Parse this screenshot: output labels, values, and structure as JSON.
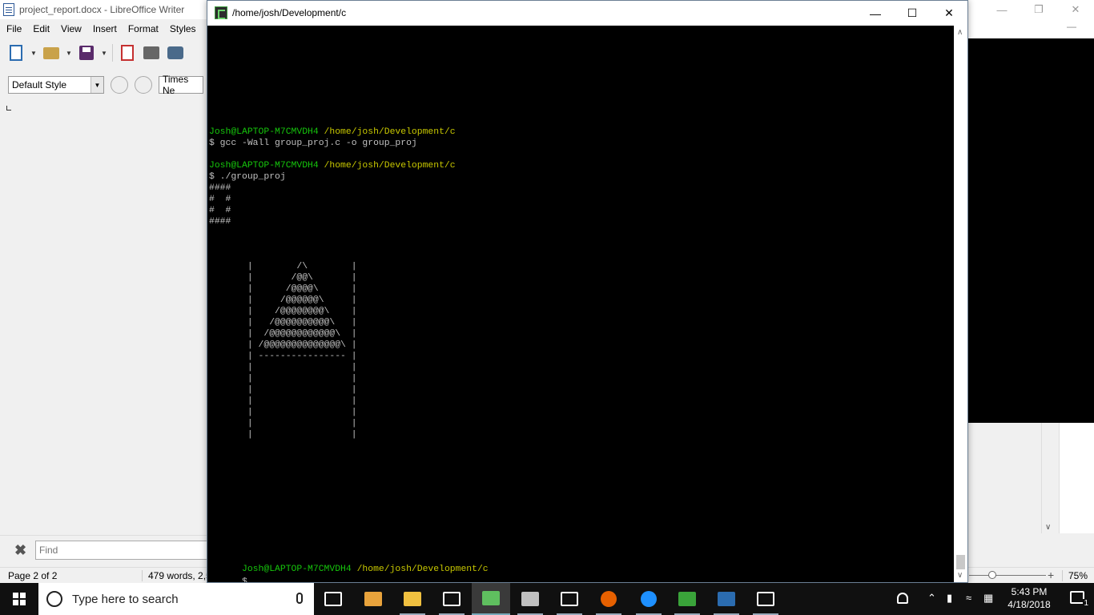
{
  "writer": {
    "title": "project_report.docx - LibreOffice Writer",
    "menu": [
      "File",
      "Edit",
      "View",
      "Insert",
      "Format",
      "Styles"
    ],
    "paragraph_style": "Default Style",
    "font_name": "Times Ne",
    "find_placeholder": "Find",
    "status": {
      "page": "Page 2 of 2",
      "words": "479 words, 2,5",
      "zoom": "75%"
    }
  },
  "terminal": {
    "title": "/home/josh/Development/c",
    "lines": [
      {
        "green": "Josh@LAPTOP-M7CMVDH4",
        "yellow": " /home/josh/Development/c",
        "text": ""
      },
      {
        "green": "",
        "yellow": "",
        "text": "$ gcc -Wall group_proj.c -o group_proj"
      },
      {
        "green": "",
        "yellow": "",
        "text": ""
      },
      {
        "green": "Josh@LAPTOP-M7CMVDH4",
        "yellow": " /home/josh/Development/c",
        "text": ""
      },
      {
        "green": "",
        "yellow": "",
        "text": "$ ./group_proj"
      },
      {
        "green": "",
        "yellow": "",
        "text": "####"
      },
      {
        "green": "",
        "yellow": "",
        "text": "#  #"
      },
      {
        "green": "",
        "yellow": "",
        "text": "#  #"
      },
      {
        "green": "",
        "yellow": "",
        "text": "####"
      },
      {
        "green": "",
        "yellow": "",
        "text": ""
      },
      {
        "green": "",
        "yellow": "",
        "text": ""
      },
      {
        "green": "",
        "yellow": "",
        "text": ""
      },
      {
        "green": "",
        "yellow": "",
        "text": "       |        /\\        |"
      },
      {
        "green": "",
        "yellow": "",
        "text": "       |       /@@\\       |"
      },
      {
        "green": "",
        "yellow": "",
        "text": "       |      /@@@@\\      |"
      },
      {
        "green": "",
        "yellow": "",
        "text": "       |     /@@@@@@\\     |"
      },
      {
        "green": "",
        "yellow": "",
        "text": "       |    /@@@@@@@@\\    |"
      },
      {
        "green": "",
        "yellow": "",
        "text": "       |   /@@@@@@@@@@\\   |"
      },
      {
        "green": "",
        "yellow": "",
        "text": "       |  /@@@@@@@@@@@@\\  |"
      },
      {
        "green": "",
        "yellow": "",
        "text": "       | /@@@@@@@@@@@@@@\\ |"
      },
      {
        "green": "",
        "yellow": "",
        "text": "       | ---------------- |"
      },
      {
        "green": "",
        "yellow": "",
        "text": "       |                  |"
      },
      {
        "green": "",
        "yellow": "",
        "text": "       |                  |"
      },
      {
        "green": "",
        "yellow": "",
        "text": "       |                  |"
      },
      {
        "green": "",
        "yellow": "",
        "text": "       |                  |"
      },
      {
        "green": "",
        "yellow": "",
        "text": "       |                  |"
      },
      {
        "green": "",
        "yellow": "",
        "text": "       |                  |"
      },
      {
        "green": "",
        "yellow": "",
        "text": "       |                  |"
      }
    ],
    "prompt_user": "Josh@LAPTOP-M7CMVDH4",
    "prompt_path": " /home/josh/Development/c",
    "prompt_symbol": "$"
  },
  "taskbar": {
    "search_placeholder": "Type here to search",
    "time": "5:43 PM",
    "date": "4/18/2018",
    "notification_count": "1",
    "apps": [
      {
        "name": "task-view-icon",
        "color": "#ffffff"
      },
      {
        "name": "store-icon",
        "color": "#e8a33c"
      },
      {
        "name": "file-explorer-icon",
        "color": "#f0c040"
      },
      {
        "name": "mail-icon",
        "color": "#ffffff"
      },
      {
        "name": "mintty-icon",
        "color": "#5fbf5f"
      },
      {
        "name": "cmd-icon",
        "color": "#c0c0c0"
      },
      {
        "name": "photos-icon",
        "color": "#ffffff"
      },
      {
        "name": "firefox-icon",
        "color": "#e66000"
      },
      {
        "name": "edge-icon",
        "color": "#1e90ff"
      },
      {
        "name": "libreoffice-calc-icon",
        "color": "#3aa33a"
      },
      {
        "name": "libreoffice-writer-icon",
        "color": "#2b6cb0"
      },
      {
        "name": "calculator-icon",
        "color": "#ffffff"
      }
    ]
  }
}
